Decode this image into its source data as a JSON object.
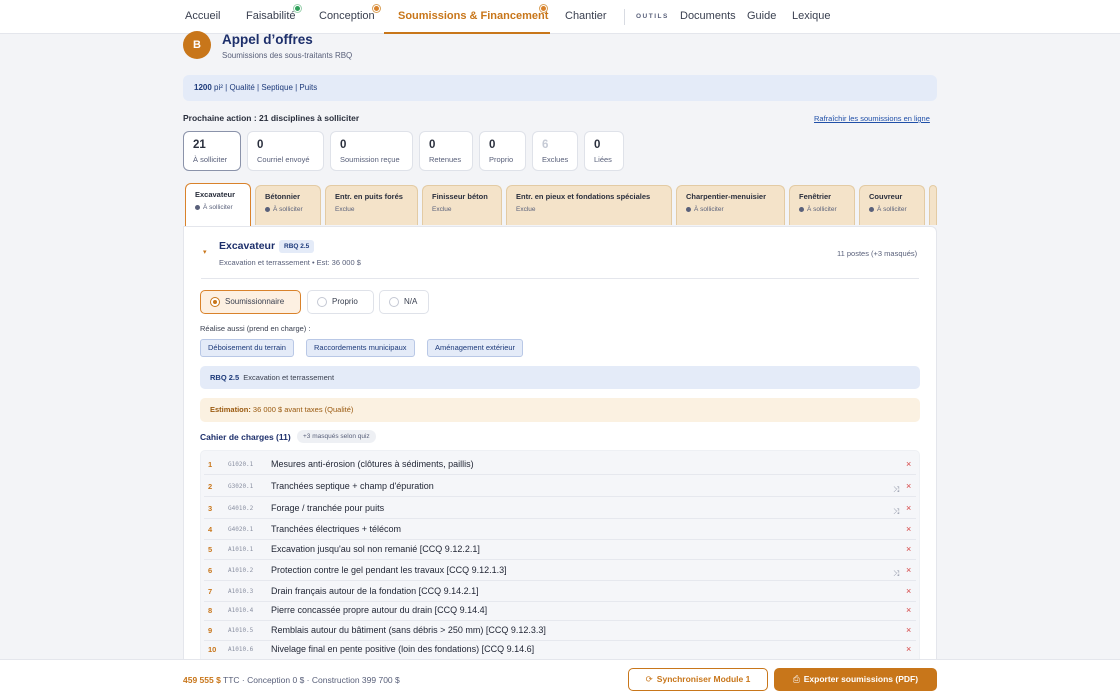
{
  "nav": {
    "items": [
      {
        "label": "Accueil"
      },
      {
        "label": "Faisabilité"
      },
      {
        "label": "Conception"
      },
      {
        "label": "Soumissions & Financement"
      },
      {
        "label": "Chantier"
      }
    ],
    "tools_label": "OUTILS",
    "tools": [
      {
        "label": "Documents"
      },
      {
        "label": "Guide"
      },
      {
        "label": "Lexique"
      }
    ],
    "dot_colors": {
      "green": "#2fa05a",
      "orange": "#d9822b"
    }
  },
  "header": {
    "badge": "B",
    "title": "Appel d’offres",
    "subtitle": "Soumissions des sous-traitants RBQ"
  },
  "info": {
    "area": "1200",
    "unit": "pi²",
    "rest": " | Qualité | Septique | Puits"
  },
  "next_action": "Prochaine action : 21 disciplines à solliciter",
  "refresh_link": "Rafraîchir les soumissions en ligne",
  "stats": [
    {
      "value": "21",
      "label": "À solliciter"
    },
    {
      "value": "0",
      "label": "Courriel envoyé"
    },
    {
      "value": "0",
      "label": "Soumission reçue"
    },
    {
      "value": "0",
      "label": "Retenues"
    },
    {
      "value": "0",
      "label": "Proprio"
    },
    {
      "value": "6",
      "label": "Exclues"
    },
    {
      "value": "0",
      "label": "Liées"
    }
  ],
  "tabs": [
    {
      "title": "Excavateur",
      "status": "À solliciter"
    },
    {
      "title": "Bétonnier",
      "status": "À solliciter"
    },
    {
      "title": "Entr. en puits forés",
      "status": "Exclue"
    },
    {
      "title": "Finisseur béton",
      "status": "Exclue"
    },
    {
      "title": "Entr. en pieux et fondations spéciales",
      "status": "Exclue"
    },
    {
      "title": "Charpentier-menuisier",
      "status": "À solliciter"
    },
    {
      "title": "Fenêtrier",
      "status": "À solliciter"
    },
    {
      "title": "Couvreur",
      "status": "À solliciter"
    }
  ],
  "trade": {
    "caret": "▾",
    "title": "Excavateur",
    "rbq": "RBQ 2.5",
    "subtitle": "Excavation et terrassement • Est: 36 000 $",
    "postes": "11 postes (+3 masqués)"
  },
  "options": [
    {
      "label": "Soumissionnaire"
    },
    {
      "label": "Proprio"
    },
    {
      "label": "N/A"
    }
  ],
  "also": {
    "label": "Réalise aussi (prend en charge) :",
    "chips": [
      {
        "label": "Déboisement du terrain"
      },
      {
        "label": "Raccordements municipaux"
      },
      {
        "label": "Aménagement extérieur"
      }
    ]
  },
  "rbq_bar": {
    "code": "RBQ 2.5",
    "text": "Excavation et terrassement"
  },
  "estimation": {
    "label": "Estimation:",
    "text": " 36 000 $ avant taxes (Qualité)"
  },
  "cahier": {
    "title": "Cahier de charges (11)",
    "masked": "+3 masqués selon quiz",
    "items": [
      {
        "num": "1",
        "code": "G1020.1",
        "text": "Mesures anti-érosion (clôtures à sédiments, paillis)",
        "remove": "×",
        "shuffle": ""
      },
      {
        "num": "2",
        "code": "G3020.1",
        "text": "Tranchées septique + champ d'épuration",
        "remove": "×",
        "shuffle": "⤨"
      },
      {
        "num": "3",
        "code": "G4010.2",
        "text": "Forage / tranchée pour puits",
        "remove": "×",
        "shuffle": "⤨"
      },
      {
        "num": "4",
        "code": "G4020.1",
        "text": "Tranchées électriques + télécom",
        "remove": "×",
        "shuffle": ""
      },
      {
        "num": "5",
        "code": "A1010.1",
        "text": "Excavation jusqu'au sol non remanié [CCQ 9.12.2.1]",
        "remove": "×",
        "shuffle": ""
      },
      {
        "num": "6",
        "code": "A1010.2",
        "text": "Protection contre le gel pendant les travaux [CCQ 9.12.1.3]",
        "remove": "×",
        "shuffle": "⤨"
      },
      {
        "num": "7",
        "code": "A1010.3",
        "text": "Drain français autour de la fondation [CCQ 9.14.2.1]",
        "remove": "×",
        "shuffle": ""
      },
      {
        "num": "8",
        "code": "A1010.4",
        "text": "Pierre concassée propre autour du drain [CCQ 9.14.4]",
        "remove": "×",
        "shuffle": ""
      },
      {
        "num": "9",
        "code": "A1010.5",
        "text": "Remblais autour du bâtiment (sans débris > 250 mm) [CCQ 9.12.3.3]",
        "remove": "×",
        "shuffle": ""
      },
      {
        "num": "10",
        "code": "A1010.6",
        "text": "Nivelage final en pente positive (loin des fondations) [CCQ 9.14.6]",
        "remove": "×",
        "shuffle": ""
      }
    ]
  },
  "footer": {
    "total": "459 555 $",
    "rest": " TTC · Conception 0 $ · Construction 399 700 $",
    "sync_label": "Synchroniser Module 1",
    "export_label": "Exporter soumissions (PDF)"
  },
  "accent_color": "#c8761a"
}
